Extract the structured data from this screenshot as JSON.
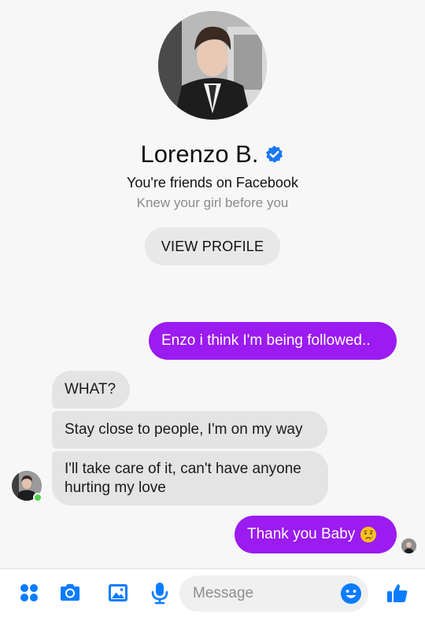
{
  "profile": {
    "name": "Lorenzo B.",
    "friends_text": "You're friends on Facebook",
    "bio": "Knew your girl before you",
    "view_profile_label": "VIEW PROFILE"
  },
  "messages": [
    {
      "direction": "out",
      "text": "Enzo i think I'm being followed.."
    },
    {
      "direction": "in",
      "text": "WHAT?"
    },
    {
      "direction": "in",
      "text": "Stay close to people, I'm on my way"
    },
    {
      "direction": "in",
      "line1": "I'll take care of it, can't have anyone",
      "line2": "hurting my love"
    },
    {
      "direction": "out",
      "text": "Thank you Baby",
      "emoji": "sad-relieved-face-emoji"
    }
  ],
  "composer": {
    "placeholder": "Message",
    "icons": [
      "apps-icon",
      "camera-icon",
      "gallery-icon",
      "microphone-icon",
      "emoji-icon",
      "thumbs-up-icon"
    ]
  },
  "colors": {
    "accent": "#9b1bf0",
    "icon_blue": "#0a7cff",
    "incoming_bubble": "#e4e4e4",
    "online": "#4bd44b"
  }
}
